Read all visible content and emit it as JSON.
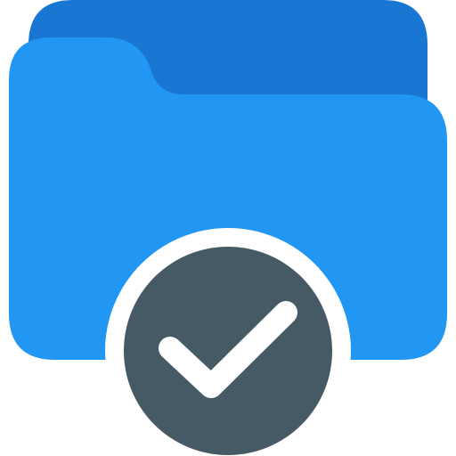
{
  "icon": {
    "name": "folder-check-icon",
    "colors": {
      "folder_back": "#1976D2",
      "folder_front": "#2196F3",
      "badge_ring": "#FFFFFF",
      "badge_fill": "#455A64",
      "check": "#FFFFFF"
    }
  }
}
